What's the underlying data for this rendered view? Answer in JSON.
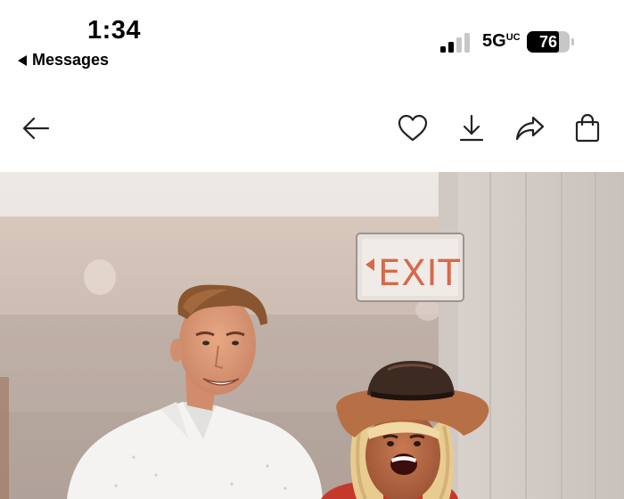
{
  "status_bar": {
    "time": "1:34",
    "back_app_label": "Messages",
    "network": "5G",
    "network_suffix": "UC",
    "battery": "76"
  },
  "toolbar": {
    "back": "arrow-left-icon",
    "favorite": "heart-icon",
    "download": "download-icon",
    "share": "share-icon",
    "shop": "shopping-bag-icon"
  },
  "photo": {
    "exit_sign": "EXIT"
  },
  "colors": {
    "exit_red": "#d6694a",
    "background": "#ffffff"
  }
}
